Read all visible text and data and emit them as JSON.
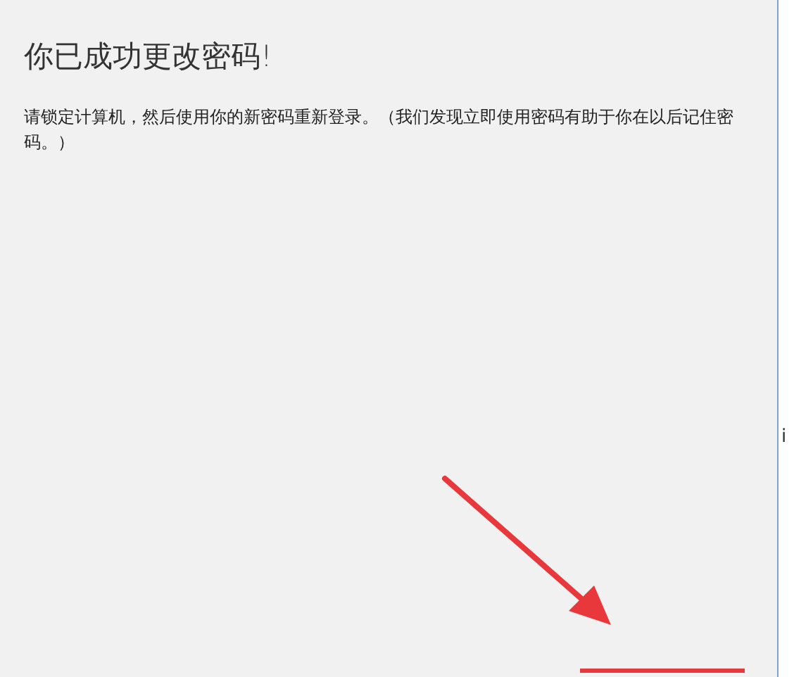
{
  "dialog": {
    "title": "你已成功更改密码!",
    "message": "请锁定计算机，然后使用你的新密码重新登录。（我们发现立即使用密码有助于你在以后记住密码。）"
  },
  "side_text": "i"
}
